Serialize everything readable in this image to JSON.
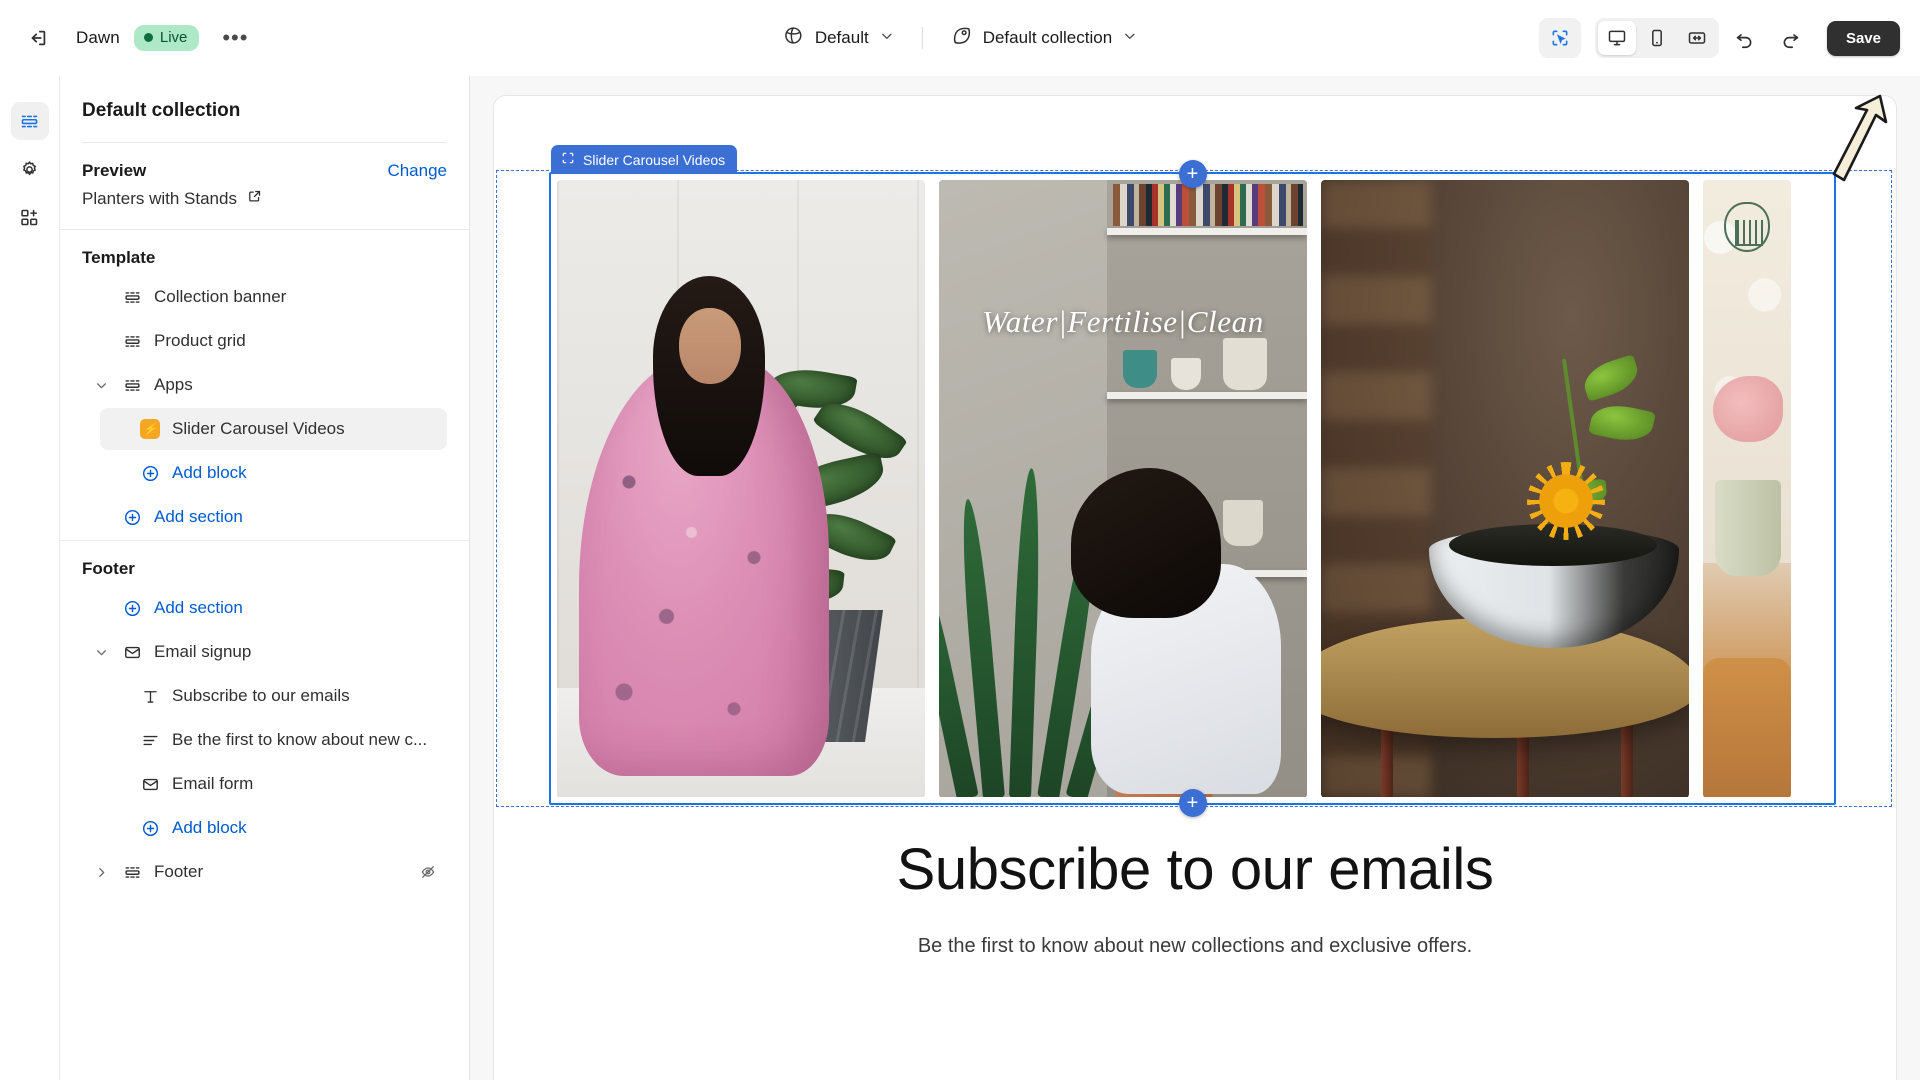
{
  "topbar": {
    "exit_icon": "exit-icon",
    "store_name": "Dawn",
    "status_label": "Live",
    "more_label": "•••",
    "market_selector": {
      "icon": "globe-icon",
      "value": "Default",
      "chevron": "chevron-down-icon"
    },
    "template_selector": {
      "icon": "tag-icon",
      "value": "Default collection",
      "chevron": "chevron-down-icon"
    },
    "tools": {
      "select_tool": "inspector-select-icon",
      "desktop": "desktop-icon",
      "mobile": "mobile-icon",
      "fullwidth": "fullwidth-icon",
      "undo": "undo-icon",
      "redo": "redo-icon"
    },
    "save_label": "Save"
  },
  "rail": {
    "items": [
      {
        "name": "sections-icon",
        "active": true
      },
      {
        "name": "settings-gear-icon",
        "active": false
      },
      {
        "name": "apps-add-icon",
        "active": false
      }
    ]
  },
  "sidebar": {
    "title": "Default collection",
    "preview": {
      "label": "Preview",
      "change_label": "Change",
      "value": "Planters with Stands",
      "external_icon": "external-link-icon"
    },
    "template": {
      "heading": "Template",
      "rows": [
        {
          "label": "Collection banner",
          "icon": "section-icon",
          "indent": 0,
          "caret": "",
          "selected": false,
          "link": false
        },
        {
          "label": "Product grid",
          "icon": "section-icon",
          "indent": 0,
          "caret": "",
          "selected": false,
          "link": false
        },
        {
          "label": "Apps",
          "icon": "section-icon",
          "indent": 0,
          "caret": "chevron-down-icon",
          "selected": false,
          "link": false
        },
        {
          "label": "Slider Carousel Videos",
          "icon": "app-block-icon",
          "indent": 1,
          "caret": "",
          "selected": true,
          "link": false
        },
        {
          "label": "Add block",
          "icon": "plus-circle-icon",
          "indent": 1,
          "caret": "",
          "selected": false,
          "link": true
        },
        {
          "label": "Add section",
          "icon": "plus-circle-icon",
          "indent": 0,
          "caret": "",
          "selected": false,
          "link": true
        }
      ]
    },
    "footer": {
      "heading": "Footer",
      "rows": [
        {
          "label": "Add section",
          "icon": "plus-circle-icon",
          "indent": 0,
          "caret": "",
          "selected": false,
          "link": true,
          "hidden_icon": false
        },
        {
          "label": "Email signup",
          "icon": "email-icon",
          "indent": 0,
          "caret": "chevron-down-icon",
          "selected": false,
          "link": false,
          "hidden_icon": false
        },
        {
          "label": "Subscribe to our emails",
          "icon": "text-icon",
          "indent": 1,
          "caret": "",
          "selected": false,
          "link": false,
          "hidden_icon": false
        },
        {
          "label": "Be the first to know about new c...",
          "icon": "paragraph-icon",
          "indent": 1,
          "caret": "",
          "selected": false,
          "link": false,
          "hidden_icon": false
        },
        {
          "label": "Email form",
          "icon": "email-icon",
          "indent": 1,
          "caret": "",
          "selected": false,
          "link": false,
          "hidden_icon": false
        },
        {
          "label": "Add block",
          "icon": "plus-circle-icon",
          "indent": 1,
          "caret": "",
          "selected": false,
          "link": true,
          "hidden_icon": false
        },
        {
          "label": "Footer",
          "icon": "footer-icon",
          "indent": 0,
          "caret": "chevron-right-icon",
          "selected": false,
          "link": false,
          "hidden_icon": true
        }
      ]
    }
  },
  "canvas": {
    "section_badge": {
      "icon": "app-section-icon",
      "label": "Slider Carousel Videos"
    },
    "add_block_top": "+",
    "add_block_bottom": "+",
    "carousel": {
      "slides": [
        {
          "name": "video-slide-1",
          "caption": ""
        },
        {
          "name": "video-slide-2",
          "caption": "Water|Fertilise|Clean"
        },
        {
          "name": "video-slide-3",
          "caption": ""
        },
        {
          "name": "video-slide-4",
          "caption": ""
        }
      ]
    },
    "subscribe": {
      "heading": "Subscribe to our emails",
      "paragraph": "Be the first to know about new collections and exclusive offers."
    }
  },
  "colors": {
    "accent_blue": "#005bd3",
    "section_blue": "#3b6fd4",
    "live_green_bg": "#aee9c7",
    "live_green_text": "#0c5132",
    "save_dark": "#303030",
    "app_orange": "#f5a623",
    "annotation_arrow": "#f5efd9"
  }
}
